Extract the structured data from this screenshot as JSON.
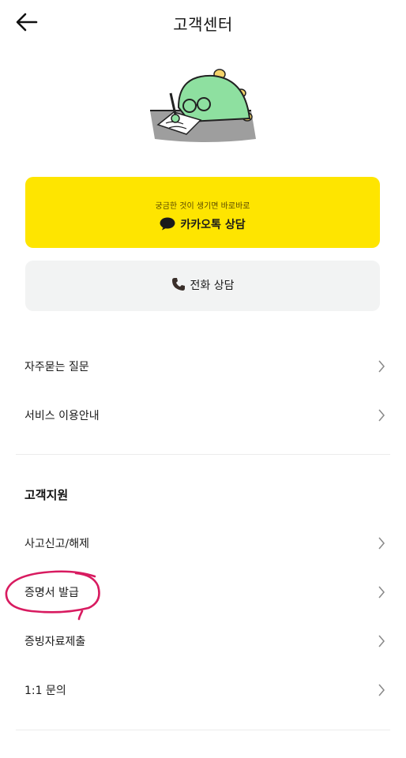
{
  "header": {
    "title": "고객센터"
  },
  "kakao": {
    "subtitle": "궁금한 것이 생기면 바로바로",
    "label": "카카오톡 상담"
  },
  "phone": {
    "label": "전화 상담"
  },
  "menu_top": [
    {
      "label": "자주묻는 질문"
    },
    {
      "label": "서비스 이용안내"
    }
  ],
  "support": {
    "title": "고객지원",
    "items": [
      {
        "label": "사고신고/해제"
      },
      {
        "label": "증명서 발급"
      },
      {
        "label": "증빙자료제출"
      },
      {
        "label": "1:1 문의"
      }
    ]
  },
  "colors": {
    "kakao_yellow": "#FEE500",
    "annotation": "#d81b60",
    "mascot_green": "#8ee0a0"
  }
}
